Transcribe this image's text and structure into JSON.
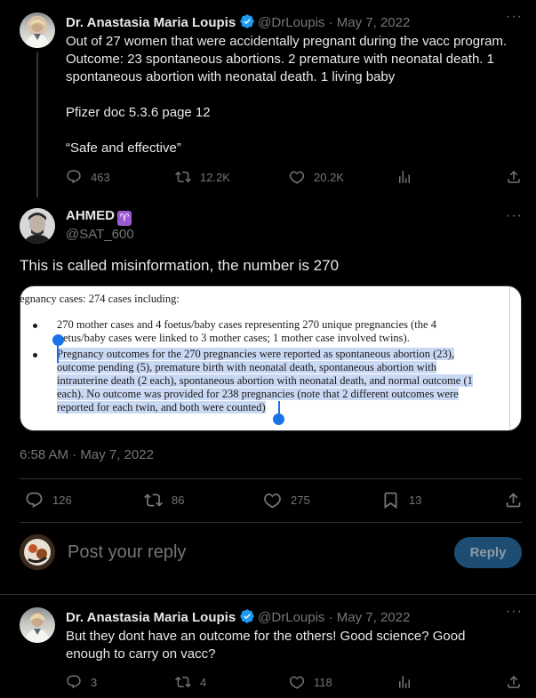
{
  "tweet1": {
    "name": "Dr. Anastasia Maria Loupis",
    "handle": "@DrLoupis",
    "date": "May 7, 2022",
    "text": "Out of 27 women that were accidentally pregnant during the vacc program. Outcome: 23 spontaneous abortions. 2 premature with neonatal death. 1 spontaneous abortion with neonatal death. 1 living baby",
    "text2": "Pfizer doc 5.3.6 page 12",
    "text3": "“Safe and effective”",
    "replies": "463",
    "reposts": "12.2K",
    "likes": "20.2K",
    "more_icon": "more-icon"
  },
  "main_tweet": {
    "name": "AHMED",
    "name_emoji": "♈",
    "handle": "@SAT_600",
    "text": "This is called misinformation, the number is 270",
    "timestamp": "6:58 AM · May 7, 2022",
    "replies": "126",
    "reposts": "86",
    "likes": "275",
    "bookmarks": "13"
  },
  "doc_image": {
    "line1": "egnancy cases: 274 cases including:",
    "bullet1_a": "270 mother cases and 4 foetus/baby cases representing 270 unique pregnancies (the 4",
    "bullet1_b": "etus/baby cases were linked to 3 mother cases; 1 mother case involved twins).",
    "bullet2_a": "Pregnancy outcomes for the 270 pregnancies were reported as spontaneous abortion (23),",
    "bullet2_b": "outcome pending (5), premature birth with neonatal death, spontaneous abortion with",
    "bullet2_c": "intrauterine death (2 each), spontaneous abortion with neonatal death, and normal outcome (1",
    "bullet2_d": "each). No outcome was provided for 238 pregnancies (note that 2 different outcomes were",
    "bullet2_e": "reported for each twin, and both were counted)"
  },
  "compose": {
    "placeholder": "Post your reply",
    "button": "Reply"
  },
  "tweet3": {
    "name": "Dr. Anastasia Maria Loupis",
    "handle": "@DrLoupis",
    "date": "May 7, 2022",
    "text": "But they dont have an outcome for the others! Good science? Good enough to carry on vacc?",
    "replies": "3",
    "reposts": "4",
    "likes": "118"
  },
  "colors": {
    "accent": "#1d9bf0",
    "verified": "#1d9bf0",
    "reply_button": "#1d4d72",
    "muted": "#71767b"
  }
}
